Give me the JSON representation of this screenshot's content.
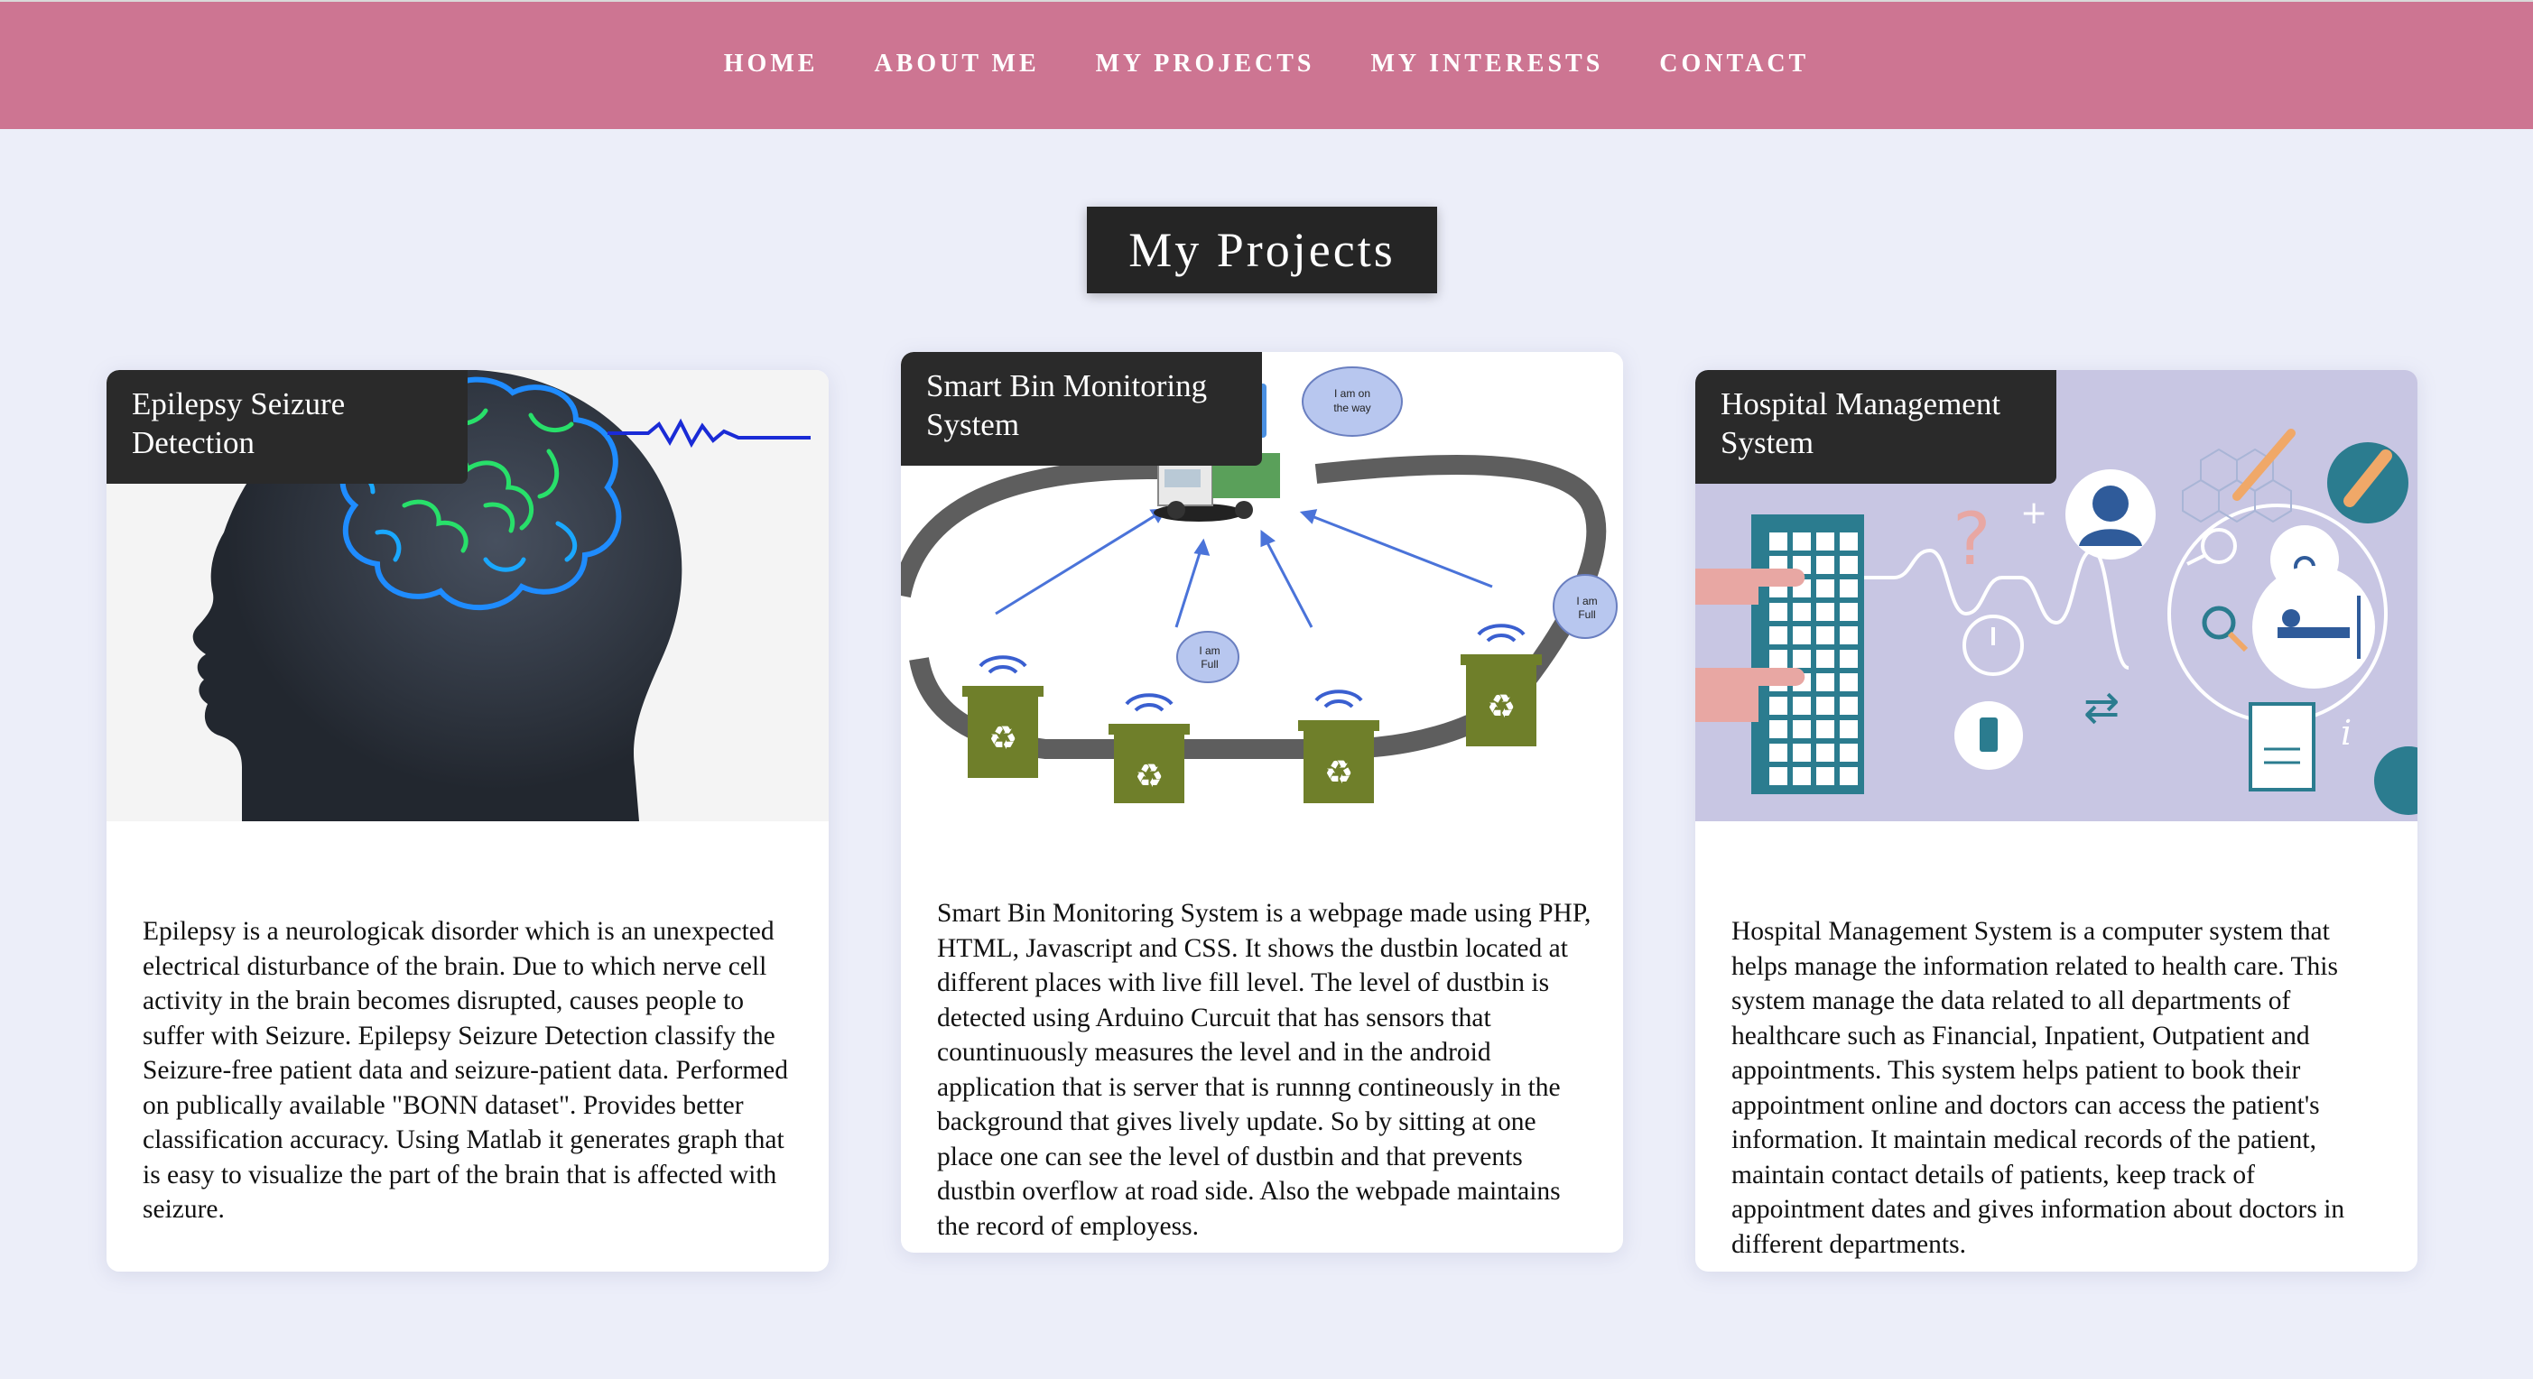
{
  "nav": {
    "items": [
      "HOME",
      "ABOUT ME",
      "MY PROJECTS",
      "MY INTERESTS",
      "CONTACT"
    ]
  },
  "section_title": "My Projects",
  "projects": [
    {
      "title": "Epilepsy Seizure Detection",
      "image_icon": "brain-head-silhouette",
      "description": "Epilepsy is a neurologicak disorder which is an unexpected electrical disturbance of the brain. Due to which nerve cell activity in the brain becomes disrupted, causes people to suffer with Seizure. Epilepsy Seizure Detection classify the Seizure-free patient data and seizure-patient data. Performed on publically available \"BONN dataset\". Provides better classification accuracy. Using Matlab it generates graph that is easy to visualize the part of the brain that is affected with seizure."
    },
    {
      "title": "Smart Bin Monitoring System",
      "image_icon": "smart-bin-diagram",
      "bubbles": {
        "truck": "I am on the way",
        "bin_right": "I am Full",
        "bin_mid": "I am Full"
      },
      "description": "Smart Bin Monitoring System is a webpage made using PHP, HTML, Javascript and CSS. It shows the dustbin located at different places with live fill level. The level of dustbin is detected using Arduino Curcuit that has sensors that countinuously measures the level and in the android application that is server that is runnng contineously in the background that gives lively update. So by sitting at one place one can see the level of dustbin and that prevents dustbin overflow at road side. Also the webpade maintains the record of employess."
    },
    {
      "title": "Hospital Management System",
      "image_icon": "hospital-illustration",
      "description": "Hospital Management System is a computer system that helps manage the information related to health care. This system manage the data related to all departments of healthcare such as Financial, Inpatient, Outpatient and appointments. This system helps patient to book their appointment online and doctors can access the patient's information. It maintain medical records of the patient, maintain contact details of patients, keep track of appointment dates and gives information about doctors in different departments."
    }
  ],
  "colors": {
    "navbar": "#cd7592",
    "page_background": "#eceef9",
    "title_background": "#252525",
    "card_background": "#ffffff",
    "label_background": "#2a2a2a"
  }
}
